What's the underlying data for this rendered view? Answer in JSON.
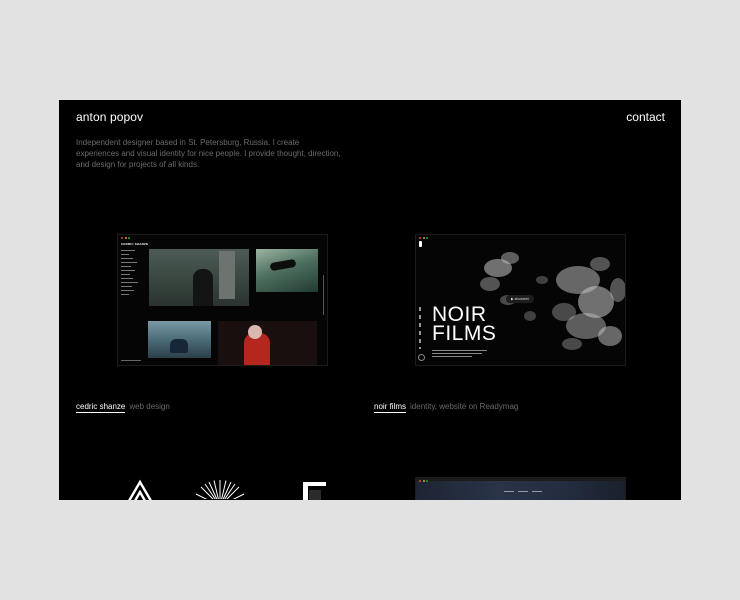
{
  "header": {
    "brand": "anton popov",
    "contact": "contact",
    "intro": "Independent designer based in St. Petersburg, Russia. I create experiences and visual identity for nice people. I provide thought, direction, and design for projects of all kinds."
  },
  "projects": [
    {
      "title": "cedric shanze",
      "description": "web design"
    },
    {
      "title": "noir films",
      "description": "identity, website on Readymag"
    }
  ],
  "mockups": {
    "cedric": {
      "logo": "CEDRIC SHANZE"
    },
    "noir": {
      "title_line1": "NOIR",
      "title_line2": "FILMS",
      "button": "showreel"
    }
  },
  "colors": {
    "page_background": "#e2e2e2",
    "site_background": "#000000",
    "text_primary": "#ffffff",
    "text_secondary": "#6a6a6a"
  }
}
